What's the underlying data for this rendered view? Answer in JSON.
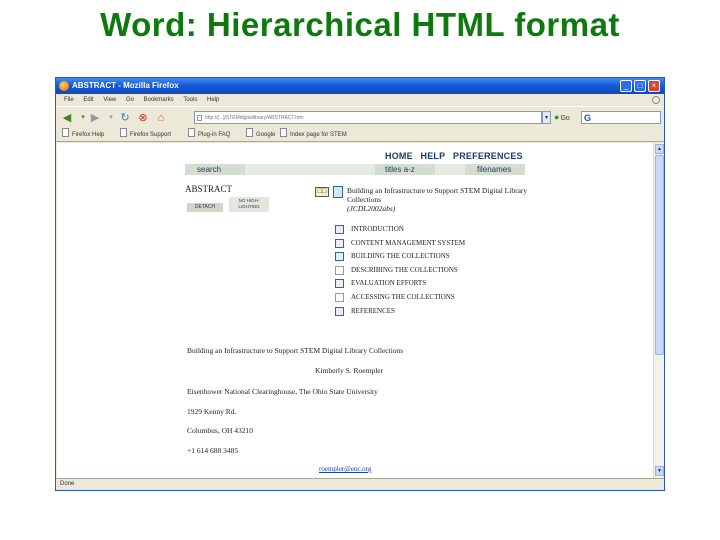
{
  "slide": {
    "title": "Word: Hierarchical HTML format"
  },
  "window": {
    "title": "ABSTRACT - Mozilla Firefox",
    "buttons": {
      "minimize": "_",
      "maximize": "□",
      "close": "×"
    }
  },
  "menubar": {
    "items": [
      "File",
      "Edit",
      "View",
      "Go",
      "Bookmarks",
      "Tools",
      "Help"
    ]
  },
  "navbar": {
    "url": "http://[...]/STEMdigitallibrary/ABSTRACT.htm",
    "go_label": "Go",
    "search_logo": "G"
  },
  "bookmarks": [
    "Firefox Help",
    "Firefox Support",
    "Plug-in FAQ",
    "Google",
    "Index page for STEM"
  ],
  "page": {
    "topnav": [
      "HOME",
      "HELP",
      "PREFERENCES"
    ],
    "tabs": [
      "search",
      "titles a-z",
      "filenames"
    ],
    "abstract_title": "ABSTRACT",
    "detach_label": "DETACH",
    "nohighlight_label": "NO HIGH-LIGHTING",
    "book_icon": "□□",
    "doc_title": "Building an Infrastructure to Support STEM Digital Library Collections",
    "doc_subtitle": "(JCDL2002abs)",
    "toc": [
      {
        "label": "INTRODUCTION",
        "checked": true
      },
      {
        "label": "CONTENT MANAGEMENT SYSTEM",
        "checked": true
      },
      {
        "label": "BUILDING THE COLLECTIONS",
        "checked": true
      },
      {
        "label": "DESCRIBING THE COLLECTIONS",
        "checked": false
      },
      {
        "label": "EVALUATION EFFORTS",
        "checked": true
      },
      {
        "label": "ACCESSING THE COLLECTIONS",
        "checked": false
      },
      {
        "label": "REFERENCES",
        "checked": true
      }
    ],
    "body": {
      "heading": "Building an Infrastructure to Support STEM Digital Library Collections",
      "author": "Kimberly S. Roempler",
      "org": "Eisenhower National Clearinghouse, The Ohio State University",
      "street": "1929 Kenny Rd.",
      "city": "Columbus, OH 43210",
      "phone": "+1 614 688 3485",
      "email": "roempler@enc.org"
    }
  },
  "status": {
    "text": "Done"
  }
}
